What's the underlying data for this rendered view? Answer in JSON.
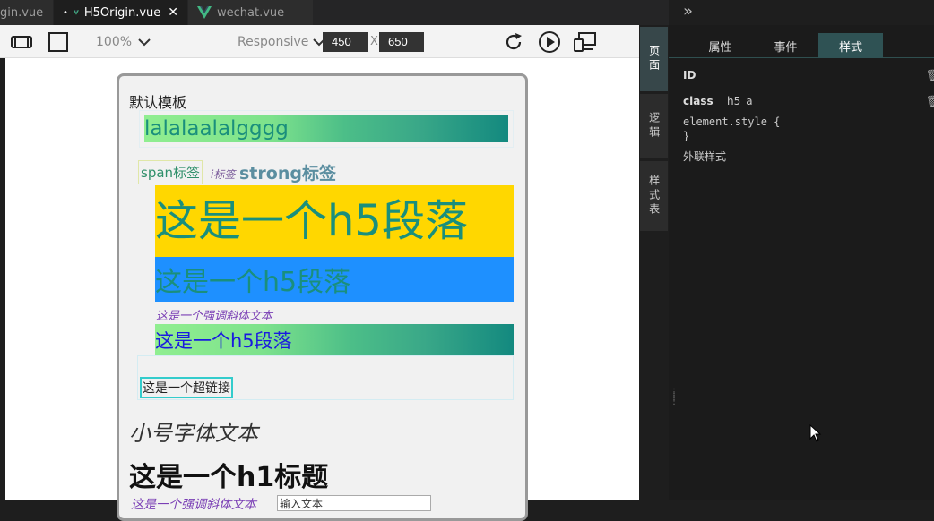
{
  "tabs": [
    {
      "label": "gin.vue",
      "active": false,
      "modified": false
    },
    {
      "label": "H5Origin.vue",
      "active": true,
      "modified": true
    },
    {
      "label": "wechat.vue",
      "active": false,
      "modified": false
    }
  ],
  "toolbar": {
    "zoom": "100%",
    "device_mode": "Responsive",
    "width": "450",
    "separator": "X",
    "height": "650"
  },
  "preview": {
    "default_template": "默认模板",
    "gradient_text": "lalalaalalgggg",
    "span_tag": "span标签",
    "small_tag": "i标签",
    "strong_tag": "strong标签",
    "h5_yellow": "这是一个h5段落",
    "h5_blue": "这是一个h5段落",
    "em_text": "这是一个强调斜体文本",
    "h5_gradient": "这是一个h5段落",
    "link_text": "这是一个超链接",
    "small_font": "小号字体文本",
    "h1_title": "这是一个h1标题",
    "bottom_partial": "这是一个强调斜体文本",
    "bottom_input": "输入文本"
  },
  "side_nav": [
    "页面",
    "逻辑",
    "样式表"
  ],
  "panel": {
    "tabs": [
      "属性",
      "事件",
      "样式"
    ],
    "active_tab": "样式",
    "id_label": "ID",
    "class_label": "class",
    "class_value": "h5_a",
    "style_open": "element.style {",
    "style_close": "}",
    "external_style": "外联样式"
  },
  "colors": {
    "accent_tab": "#2f5254",
    "vue_green": "#42b883",
    "yellow_block": "#ffd700",
    "blue_block": "#1e90ff"
  }
}
